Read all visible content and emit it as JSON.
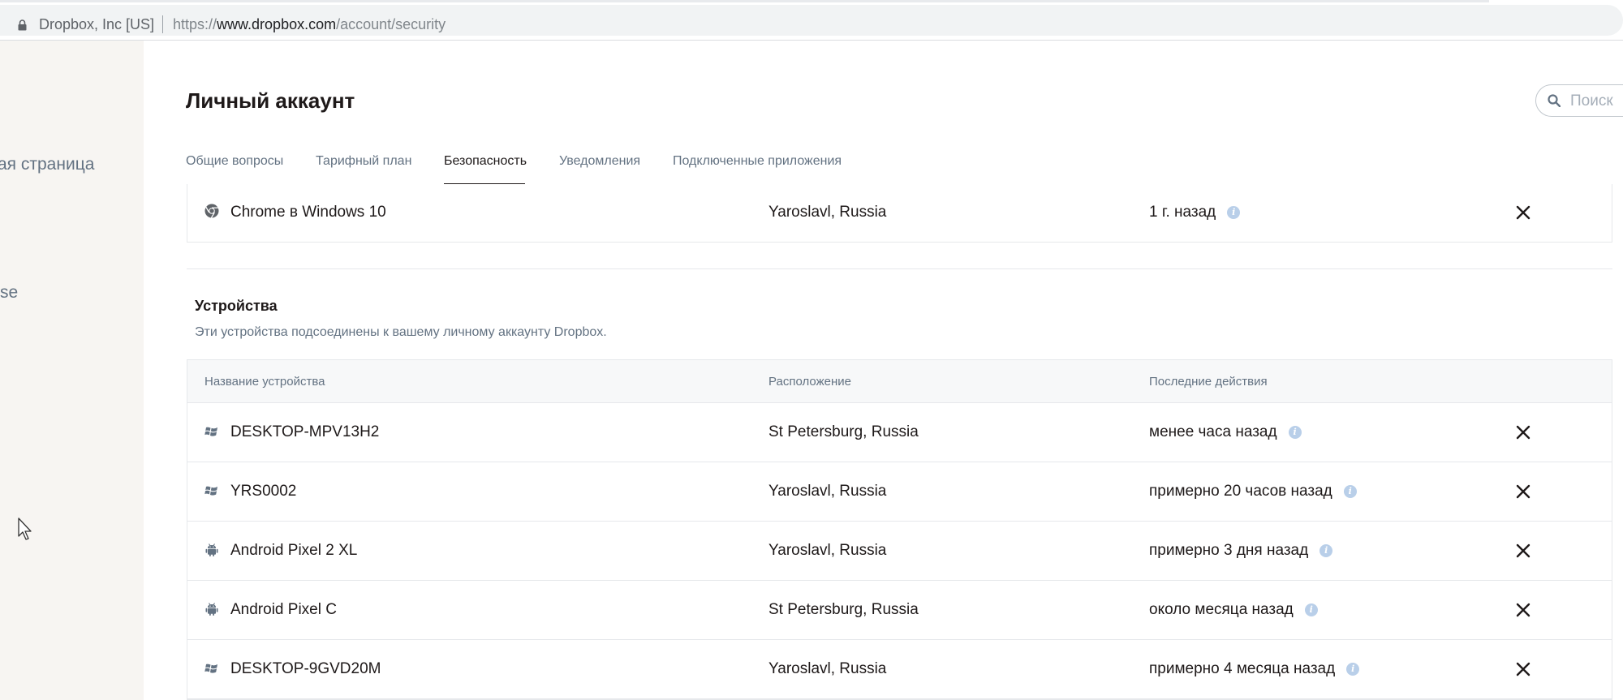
{
  "browser": {
    "site_identity": "Dropbox, Inc [US]",
    "url_scheme": "https://",
    "url_host": "www.dropbox.com",
    "url_path": "/account/security"
  },
  "sidebar": {
    "item_home_partial": "ая страница",
    "item_partial_2": "se"
  },
  "header": {
    "title": "Личный аккаунт",
    "search_placeholder": "Поиск"
  },
  "tabs": [
    {
      "label": "Общие вопросы",
      "active": false
    },
    {
      "label": "Тарифный план",
      "active": false
    },
    {
      "label": "Безопасность",
      "active": true
    },
    {
      "label": "Уведомления",
      "active": false
    },
    {
      "label": "Подключенные приложения",
      "active": false
    }
  ],
  "sessions": {
    "rows": [
      {
        "icon": "chrome-icon",
        "name": "Chrome в Windows 10",
        "location": "Yaroslavl, Russia",
        "activity": "1 г. назад"
      }
    ]
  },
  "devices": {
    "title": "Устройства",
    "description": "Эти устройства подсоединены к вашему личному аккаунту Dropbox.",
    "columns": [
      "Название устройства",
      "Расположение",
      "Последние действия"
    ],
    "rows": [
      {
        "icon": "windows-icon",
        "name": "DESKTOP-MPV13H2",
        "location": "St Petersburg, Russia",
        "activity": "менее часа назад"
      },
      {
        "icon": "windows-icon",
        "name": "YRS0002",
        "location": "Yaroslavl, Russia",
        "activity": "примерно 20 часов назад"
      },
      {
        "icon": "android-icon",
        "name": "Android Pixel 2 XL",
        "location": "Yaroslavl, Russia",
        "activity": "примерно 3 дня назад"
      },
      {
        "icon": "android-icon",
        "name": "Android Pixel C",
        "location": "St Petersburg, Russia",
        "activity": "около месяца назад"
      },
      {
        "icon": "windows-icon",
        "name": "DESKTOP-9GVD20M",
        "location": "Yaroslavl, Russia",
        "activity": "примерно 4 месяца назад"
      }
    ]
  },
  "colors": {
    "text_primary": "#1e1919",
    "text_secondary": "#637282",
    "sidebar_bg": "#f7f5f2",
    "info_icon": "#b9cfe9",
    "border": "#e6e8eb"
  }
}
